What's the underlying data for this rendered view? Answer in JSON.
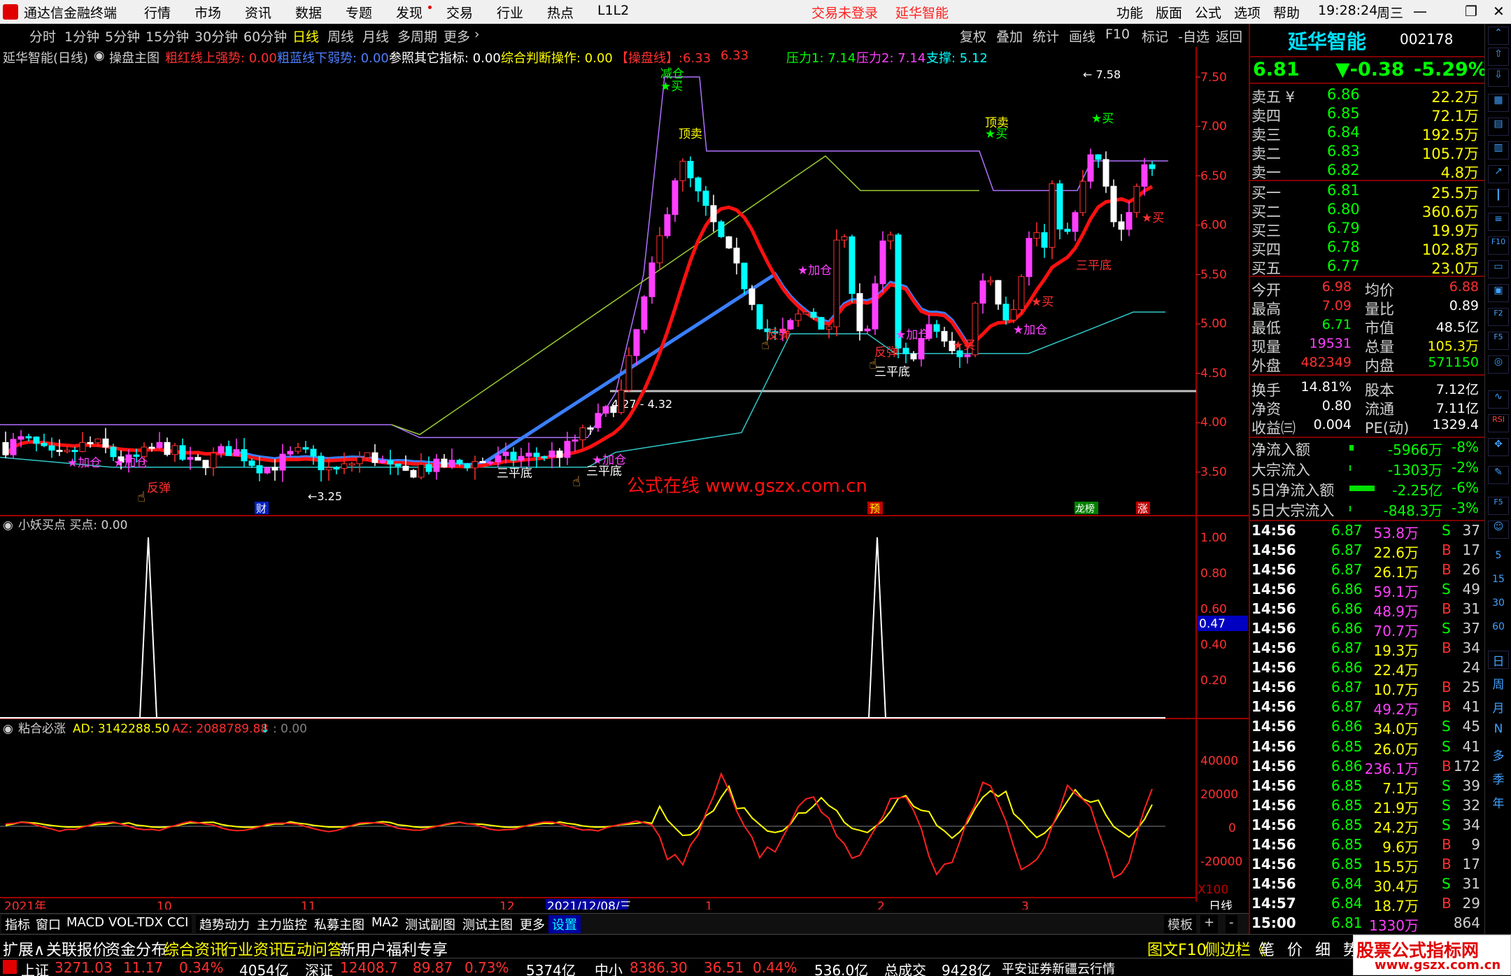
{
  "menubar": {
    "app_title": "通达信金融终端",
    "items": [
      "行情",
      "市场",
      "资讯",
      "数据",
      "专题",
      "发现",
      "交易",
      "行业",
      "热点",
      "L1L2"
    ],
    "trade_status": "交易未登录",
    "stock_name": "延华智能",
    "right_items": [
      "功能",
      "版面",
      "公式",
      "选项",
      "帮助"
    ],
    "clock": "19:28:24",
    "weekday": "周三"
  },
  "timeframes": [
    "分时",
    "1分钟",
    "5分钟",
    "15分钟",
    "30分钟",
    "60分钟",
    "日线",
    "周线",
    "月线",
    "多周期",
    "更多"
  ],
  "toolbar_right": [
    "复权",
    "叠加",
    "统计",
    "画线",
    "F10",
    "标记",
    "-自选",
    "返回"
  ],
  "main_header": {
    "title": "延华智能(日线)",
    "indicator": "操盘主图",
    "red_label": "粗红线上强势: 0.00",
    "blue_label": "粗蓝线下弱势: 0.00",
    "other_label": "参照其它指标: 0.00",
    "combo_label": "综合判断操作: 0.00",
    "caopan_label": "【操盘线】:6.33",
    "caopan_value": "6.33",
    "pressure1": "压力1: 7.14",
    "pressure2": "压力2: 7.14",
    "support": "支撑: 5.12"
  },
  "price_axis": [
    "7.50",
    "7.00",
    "6.50",
    "6.00",
    "5.50",
    "5.00",
    "4.50",
    "4.00",
    "3.50"
  ],
  "chart_data": {
    "type": "candlestick",
    "high": 7.58,
    "low": 3.25,
    "level_line_label": "4.27 - 4.32",
    "indicator1_axis": [
      "1.00",
      "0.80",
      "0.60",
      "0.40",
      "0.20"
    ],
    "indicator1_current": "0.47",
    "indicator1_header": "小妖买点  买点: 0.00",
    "indicator2_header_name": "粘合必涨",
    "indicator2_ad": "AD: 3142288.50",
    "indicator2_az": "AZ: 2088789.88",
    "indicator2_extra": ": 0.00",
    "indicator2_axis": [
      "40000",
      "20000",
      "0",
      "-20000"
    ],
    "indicator2_multiplier": "X100",
    "x_labels": [
      "2021年",
      "10",
      "11",
      "12",
      "2021/12/08/三",
      "1",
      "2",
      "3",
      "日线"
    ]
  },
  "annotations": {
    "jiacang": "★加仓",
    "fantan": "反弹",
    "sanpingdi": "三平底",
    "maimai": "★买",
    "dingmai": "顶卖",
    "jianchang": "减仓",
    "watermark": "公式在线   www.gszx.com.cn",
    "marker_cai": "财",
    "marker_yu": "预",
    "marker_long": "龙榜",
    "marker_zhang": "涨"
  },
  "quote_header": {
    "name": "延华智能",
    "code": "002178",
    "price": "6.81",
    "change": "▼-0.38",
    "pct": "-5.29%"
  },
  "orderbook": [
    {
      "label": "卖五 ¥",
      "price": "6.86",
      "vol": "22.2万"
    },
    {
      "label": "卖四",
      "price": "6.85",
      "vol": "72.1万"
    },
    {
      "label": "卖三",
      "price": "6.84",
      "vol": "192.5万"
    },
    {
      "label": "卖二",
      "price": "6.83",
      "vol": "105.7万"
    },
    {
      "label": "卖一",
      "price": "6.82",
      "vol": "4.8万"
    },
    {
      "label": "买一",
      "price": "6.81",
      "vol": "25.5万"
    },
    {
      "label": "买二",
      "price": "6.80",
      "vol": "360.6万"
    },
    {
      "label": "买三",
      "price": "6.79",
      "vol": "19.9万"
    },
    {
      "label": "买四",
      "price": "6.78",
      "vol": "102.8万"
    },
    {
      "label": "买五",
      "price": "6.77",
      "vol": "23.0万"
    }
  ],
  "stats": [
    {
      "l1": "今开",
      "v1": "6.98",
      "l2": "均价",
      "v2": "6.88"
    },
    {
      "l1": "最高",
      "v1": "7.09",
      "l2": "量比",
      "v2": "0.89"
    },
    {
      "l1": "最低",
      "v1": "6.71",
      "l2": "市值",
      "v2": "48.5亿"
    },
    {
      "l1": "现量",
      "v1": "19531",
      "l2": "总量",
      "v2": "105.3万"
    },
    {
      "l1": "外盘",
      "v1": "482349",
      "l2": "内盘",
      "v2": "571150"
    }
  ],
  "stats2": [
    {
      "l1": "换手",
      "v1": "14.81%",
      "l2": "股本",
      "v2": "7.12亿"
    },
    {
      "l1": "净资",
      "v1": "0.80",
      "l2": "流通",
      "v2": "7.11亿"
    },
    {
      "l1": "收益㈢",
      "v1": "0.004",
      "l2": "PE(动)",
      "v2": "1329.4"
    }
  ],
  "flows": [
    {
      "label": "净流入额",
      "val": "-5966万",
      "pct": "-8%"
    },
    {
      "label": "大宗流入",
      "val": "-1303万",
      "pct": "-2%"
    },
    {
      "label": "5日净流入额",
      "val": "-2.25亿",
      "pct": "-6%"
    },
    {
      "label": "5日大宗流入",
      "val": "-848.3万",
      "pct": "-3%"
    }
  ],
  "trades": [
    {
      "t": "14:56",
      "p": "6.87",
      "v": "53.8万",
      "s": "S",
      "n": "37"
    },
    {
      "t": "14:56",
      "p": "6.87",
      "v": "22.6万",
      "s": "B",
      "n": "17"
    },
    {
      "t": "14:56",
      "p": "6.87",
      "v": "26.1万",
      "s": "B",
      "n": "26"
    },
    {
      "t": "14:56",
      "p": "6.86",
      "v": "59.1万",
      "s": "S",
      "n": "49"
    },
    {
      "t": "14:56",
      "p": "6.86",
      "v": "48.9万",
      "s": "B",
      "n": "31"
    },
    {
      "t": "14:56",
      "p": "6.86",
      "v": "70.7万",
      "s": "S",
      "n": "37"
    },
    {
      "t": "14:56",
      "p": "6.87",
      "v": "19.3万",
      "s": "B",
      "n": "34"
    },
    {
      "t": "14:56",
      "p": "6.86",
      "v": "22.4万",
      "s": "",
      "n": "24"
    },
    {
      "t": "14:56",
      "p": "6.87",
      "v": "10.7万",
      "s": "B",
      "n": "25"
    },
    {
      "t": "14:56",
      "p": "6.87",
      "v": "49.2万",
      "s": "B",
      "n": "41"
    },
    {
      "t": "14:56",
      "p": "6.86",
      "v": "34.0万",
      "s": "S",
      "n": "45"
    },
    {
      "t": "14:56",
      "p": "6.85",
      "v": "26.0万",
      "s": "S",
      "n": "41"
    },
    {
      "t": "14:56",
      "p": "6.86",
      "v": "236.1万",
      "s": "B",
      "n": "172"
    },
    {
      "t": "14:56",
      "p": "6.85",
      "v": "7.1万",
      "s": "S",
      "n": "39"
    },
    {
      "t": "14:56",
      "p": "6.85",
      "v": "21.9万",
      "s": "S",
      "n": "32"
    },
    {
      "t": "14:56",
      "p": "6.85",
      "v": "24.2万",
      "s": "S",
      "n": "34"
    },
    {
      "t": "14:56",
      "p": "6.85",
      "v": "9.6万",
      "s": "B",
      "n": "9"
    },
    {
      "t": "14:56",
      "p": "6.85",
      "v": "15.5万",
      "s": "B",
      "n": "17"
    },
    {
      "t": "14:56",
      "p": "6.84",
      "v": "30.4万",
      "s": "S",
      "n": "31"
    },
    {
      "t": "14:57",
      "p": "6.84",
      "v": "18.7万",
      "s": "B",
      "n": "29"
    },
    {
      "t": "15:00",
      "p": "6.81",
      "v": "1330万",
      "s": "",
      "n": "864"
    }
  ],
  "side_tabs": [
    "日",
    "周",
    "月",
    "N",
    "多",
    "季",
    "年"
  ],
  "side_nums": [
    "5",
    "15",
    "30",
    "60"
  ],
  "bottom_tabs": [
    "指标",
    "窗口",
    "MACD",
    "VOL-TDX",
    "CCI",
    "趋势动力",
    "主力监控",
    "私募主图",
    "MA2",
    "测试副图",
    "测试主图",
    "更多",
    "设置"
  ],
  "bottom_right": [
    "模板",
    "+",
    "-"
  ],
  "info_tabs": [
    "扩展∧",
    "关联报价",
    "资金分布",
    "综合资讯",
    "行业资讯",
    "互动问答",
    "新用户福利专享"
  ],
  "info_right": [
    "图文F10",
    "侧边栏《",
    "笔",
    "价",
    "细",
    "势"
  ],
  "statusbar": {
    "sh_label": "上证",
    "sh_val": "3271.03",
    "sh_chg": "11.17",
    "sh_pct": "0.34%",
    "sh_amt": "4054亿",
    "sz_label": "深证",
    "sz_val": "12408.7",
    "sz_chg": "89.87",
    "sz_pct": "0.73%",
    "sz_amt": "5374亿",
    "zx_label": "中小",
    "zx_val": "8386.30",
    "zx_chg": "36.51",
    "zx_pct": "0.44%",
    "zx_amt": "536.0亿",
    "total_label": "总成交",
    "total_amt": "9428亿",
    "server": "平安证券新疆云行情"
  },
  "brand": {
    "line1": "股票公式指标网",
    "line2": "www.gszx.com.cn"
  }
}
